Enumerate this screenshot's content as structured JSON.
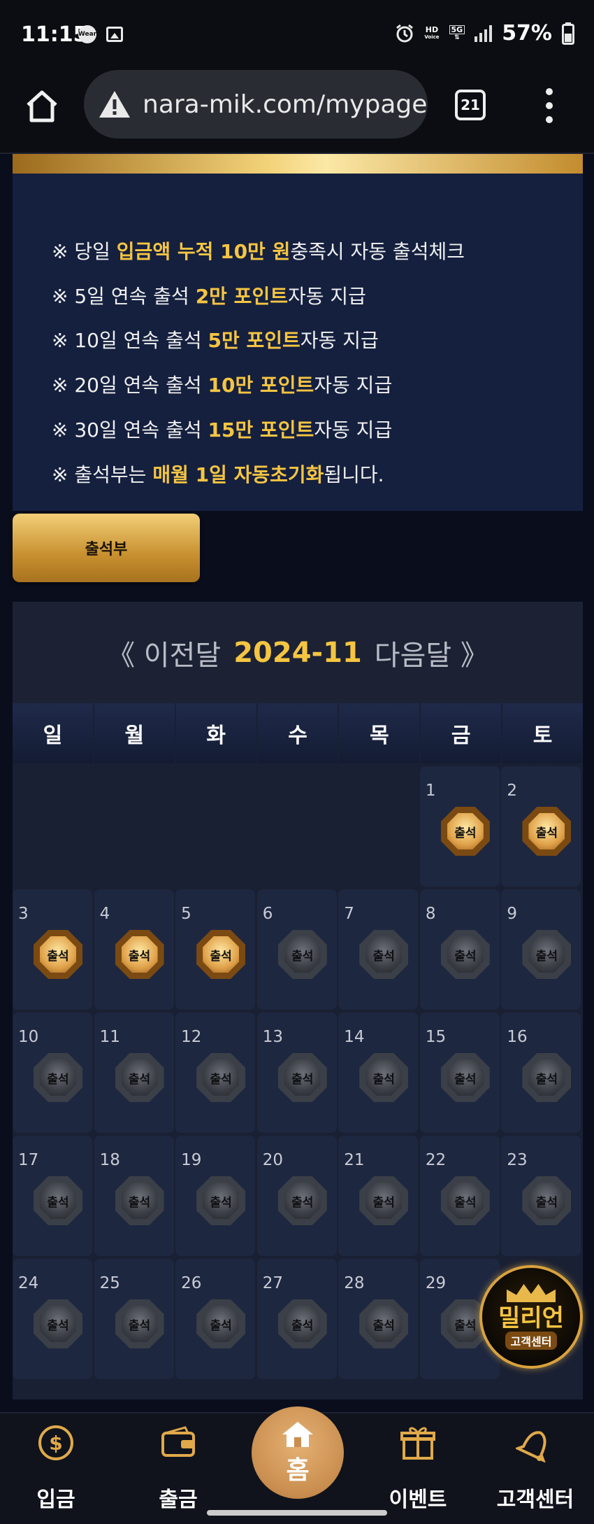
{
  "status_bar": {
    "time": "11:15",
    "wear_label": "Wear",
    "hd_label": "HD",
    "voice_label": "Voice",
    "net_label": "5G",
    "battery": "57%"
  },
  "browser": {
    "url": "nara-mik.com/mypage",
    "tab_count": "21"
  },
  "notice": {
    "lines": [
      {
        "pre": "※ 당일 ",
        "hl": "입금액 누적 10만 원",
        "post": "충족시 자동 출석체크"
      },
      {
        "pre": "※ 5일 연속 출석 ",
        "hl": "2만 포인트",
        "post": "자동 지급"
      },
      {
        "pre": "※ 10일 연속 출석 ",
        "hl": "5만 포인트",
        "post": "자동 지급"
      },
      {
        "pre": "※ 20일 연속 출석 ",
        "hl": "10만 포인트",
        "post": "자동 지급"
      },
      {
        "pre": "※ 30일 연속 출석 ",
        "hl": "15만 포인트",
        "post": "자동 지급"
      },
      {
        "pre": "※ 출석부는 ",
        "hl": "매월 1일 자동초기화",
        "post": "됩니다."
      }
    ]
  },
  "attendance_button": "출석부",
  "calendar": {
    "prev": "《 이전달",
    "year_month": "2024-11",
    "next": "다음달 》",
    "weekdays": [
      "일",
      "월",
      "화",
      "수",
      "목",
      "금",
      "토"
    ],
    "stamp_label": "출석",
    "first_weekday_index": 5,
    "days_shown": 29,
    "attended_days": [
      1,
      2,
      3,
      4,
      5
    ]
  },
  "support_float": {
    "title": "밀리언",
    "subtitle": "고객센터"
  },
  "bottom_nav": {
    "deposit": "입금",
    "withdraw": "출금",
    "home": "홈",
    "event": "이벤트",
    "support": "고객센터"
  },
  "colors": {
    "accent_gold": "#f5c542",
    "panel": "#15203f",
    "background": "#0a0e1c"
  }
}
